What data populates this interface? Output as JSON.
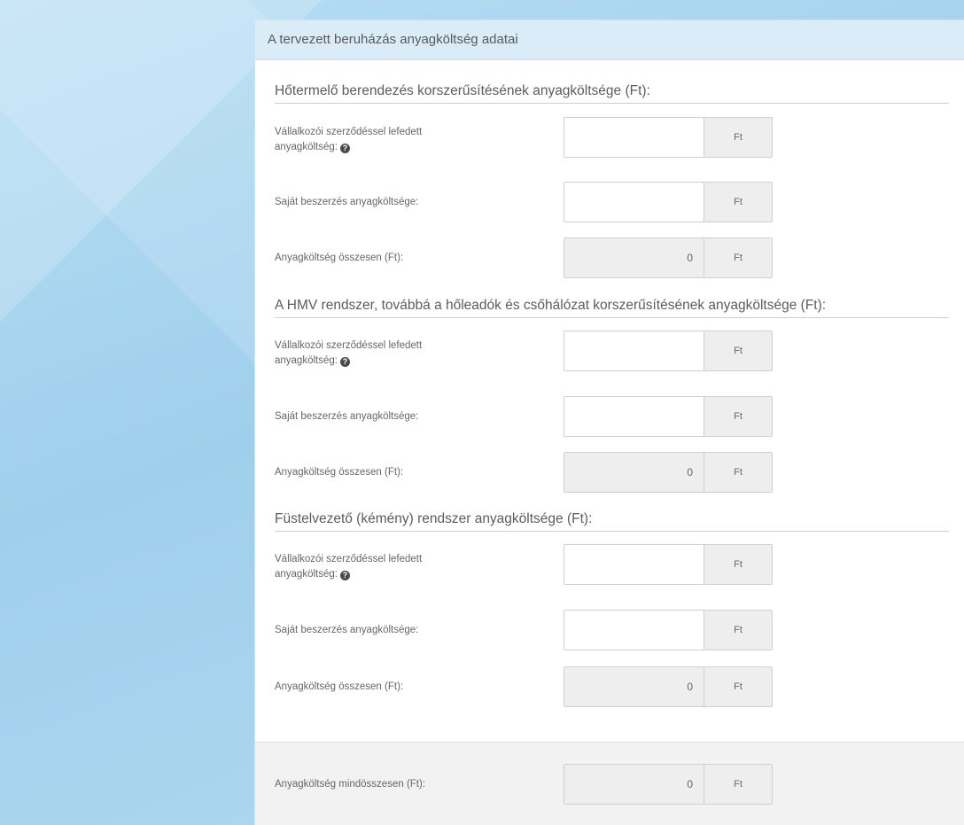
{
  "panel": {
    "title": "A tervezett beruházás anyagköltség adatai"
  },
  "sections": [
    {
      "title": "Hőtermelő berendezés korszerűsítésének anyagköltsége (Ft):",
      "rows": [
        {
          "label_line1": "Vállalkozói szerződéssel lefedett",
          "label_line2": "anyagköltség:",
          "value": "",
          "unit": "Ft"
        },
        {
          "label": "Saját beszerzés anyagköltsége:",
          "value": "",
          "unit": "Ft"
        },
        {
          "label": "Anyagköltség összesen (Ft):",
          "value": "0",
          "unit": "Ft"
        }
      ]
    },
    {
      "title": "A HMV rendszer, továbbá a hőleadók és csőhálózat korszerűsítésének anyagköltsége (Ft):",
      "rows": [
        {
          "label_line1": "Vállalkozói szerződéssel lefedett",
          "label_line2": "anyagköltség:",
          "value": "",
          "unit": "Ft"
        },
        {
          "label": "Saját beszerzés anyagköltsége:",
          "value": "",
          "unit": "Ft"
        },
        {
          "label": "Anyagköltség összesen (Ft):",
          "value": "0",
          "unit": "Ft"
        }
      ]
    },
    {
      "title": "Füstelvezető (kémény) rendszer anyagköltsége (Ft):",
      "rows": [
        {
          "label_line1": "Vállalkozói szerződéssel lefedett",
          "label_line2": "anyagköltség:",
          "value": "",
          "unit": "Ft"
        },
        {
          "label": "Saját beszerzés anyagköltsége:",
          "value": "",
          "unit": "Ft"
        },
        {
          "label": "Anyagköltség összesen (Ft):",
          "value": "0",
          "unit": "Ft"
        }
      ]
    }
  ],
  "footer": {
    "label": "Anyagköltség mindösszesen (Ft):",
    "value": "0",
    "unit": "Ft"
  },
  "help_icon_glyph": "?"
}
